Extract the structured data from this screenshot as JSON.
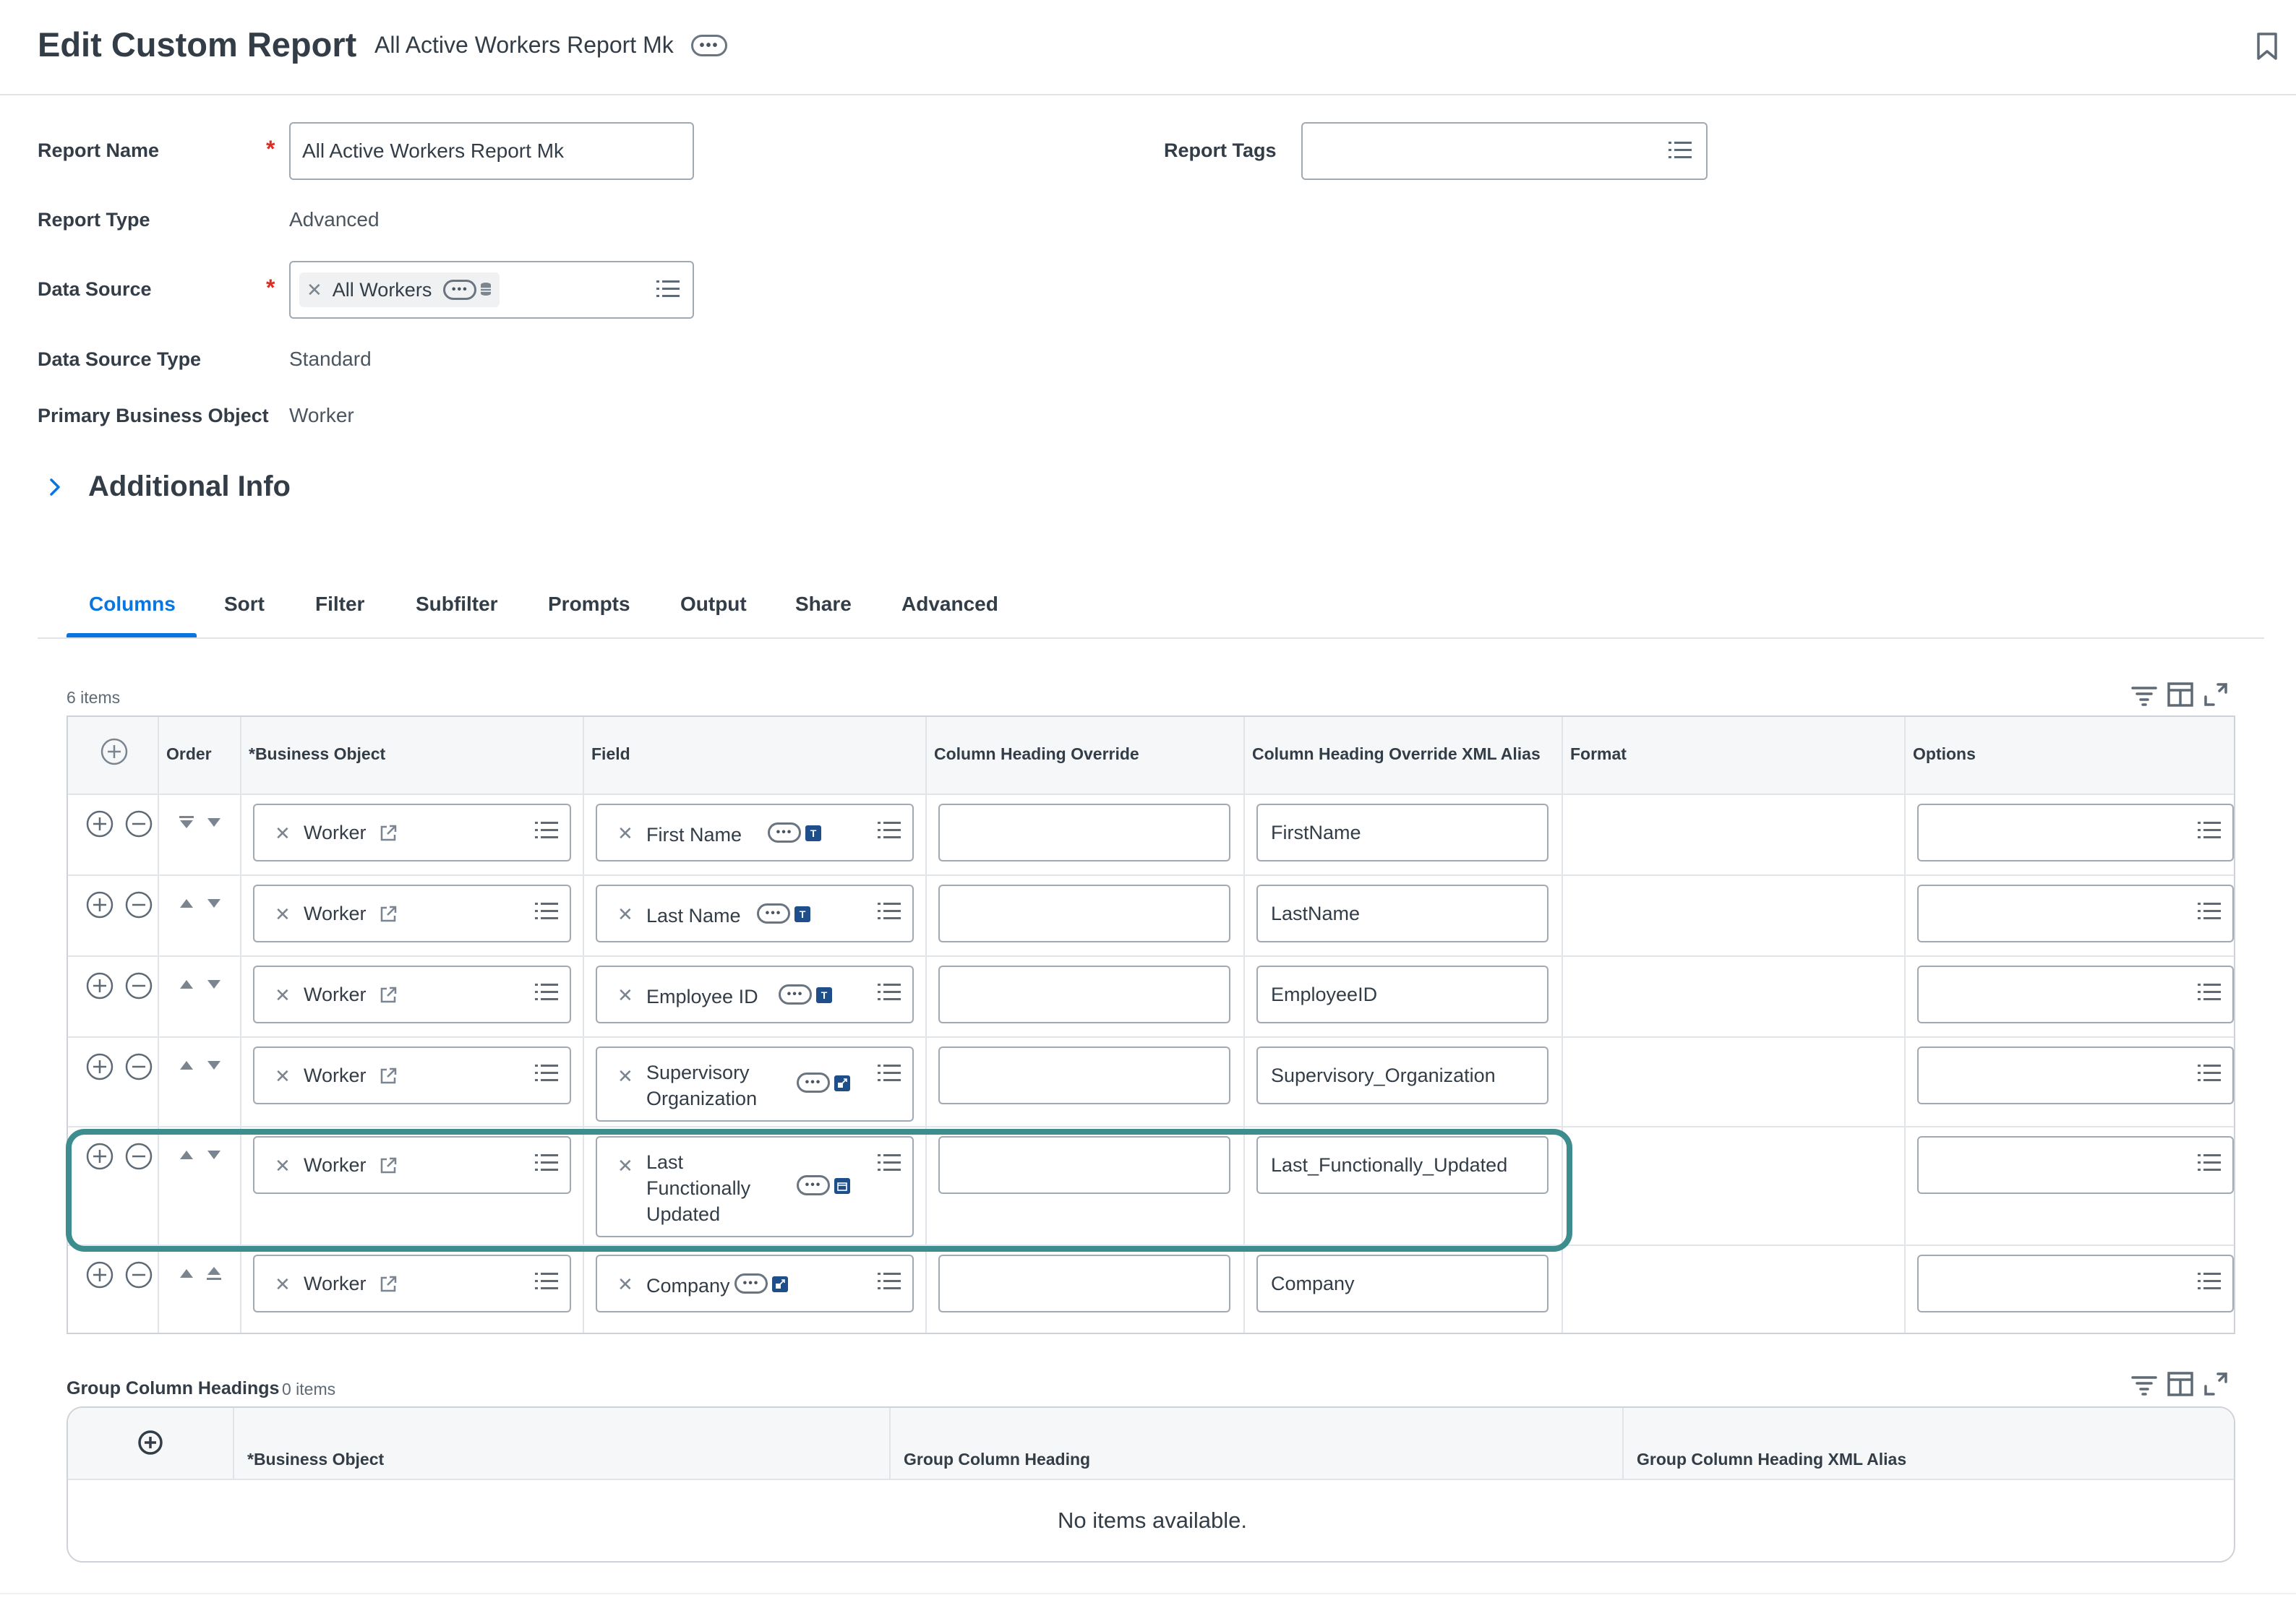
{
  "header": {
    "title": "Edit Custom Report",
    "subtitle": "All Active Workers Report Mk",
    "more_label": "•••"
  },
  "form": {
    "report_name_label": "Report Name",
    "report_name_value": "All Active Workers Report Mk",
    "report_tags_label": "Report Tags",
    "report_type_label": "Report Type",
    "report_type_value": "Advanced",
    "data_source_label": "Data Source",
    "data_source_value": "All Workers",
    "data_source_type_label": "Data Source Type",
    "data_source_type_value": "Standard",
    "primary_bo_label": "Primary Business Object",
    "primary_bo_value": "Worker",
    "required_mark": "*"
  },
  "additional_info": {
    "label": "Additional Info"
  },
  "tabs": [
    {
      "label": "Columns",
      "active": true
    },
    {
      "label": "Sort"
    },
    {
      "label": "Filter"
    },
    {
      "label": "Subfilter"
    },
    {
      "label": "Prompts"
    },
    {
      "label": "Output"
    },
    {
      "label": "Share"
    },
    {
      "label": "Advanced"
    }
  ],
  "columns_grid": {
    "count_label": "6 items",
    "headers": {
      "order": "Order",
      "business_object": "*Business Object",
      "field": "Field",
      "col_heading_override": "Column Heading Override",
      "col_heading_xml": "Column Heading Override XML Alias",
      "format": "Format",
      "options": "Options"
    },
    "rows": [
      {
        "bo": "Worker",
        "field_lines": [
          "First Name"
        ],
        "field_badge": "T",
        "heading_override": "",
        "xml_alias": "FirstName"
      },
      {
        "bo": "Worker",
        "field_lines": [
          "Last Name"
        ],
        "field_badge": "T",
        "heading_override": "",
        "xml_alias": "LastName"
      },
      {
        "bo": "Worker",
        "field_lines": [
          "Employee ID"
        ],
        "field_badge": "T",
        "heading_override": "",
        "xml_alias": "EmployeeID"
      },
      {
        "bo": "Worker",
        "field_lines": [
          "Supervisory",
          "Organization"
        ],
        "field_badge": "link",
        "heading_override": "",
        "xml_alias": "Supervisory_Organization"
      },
      {
        "bo": "Worker",
        "field_lines": [
          "Last",
          "Functionally",
          "Updated"
        ],
        "field_badge": "date",
        "heading_override": "",
        "xml_alias": "Last_Functionally_Updated",
        "highlighted": true
      },
      {
        "bo": "Worker",
        "field_lines": [
          "Company"
        ],
        "field_badge": "link",
        "heading_override": "",
        "xml_alias": "Company"
      }
    ]
  },
  "group_headings": {
    "title": "Group Column Headings",
    "count_label": "0 items",
    "headers": {
      "business_object": "*Business Object",
      "group_heading": "Group Column Heading",
      "group_heading_xml": "Group Column Heading XML Alias"
    },
    "empty_message": "No items available."
  },
  "icons": {
    "bookmark": "bookmark-icon",
    "list": "list-icon",
    "filter": "filter-icon",
    "columns": "column-chooser-icon",
    "expand": "fullscreen-icon",
    "add": "add-circle-icon",
    "remove": "remove-circle-icon",
    "external": "external-link-icon"
  },
  "colors": {
    "accent": "#0875e1",
    "highlight": "#3d8c8e",
    "required": "#de2e21"
  }
}
